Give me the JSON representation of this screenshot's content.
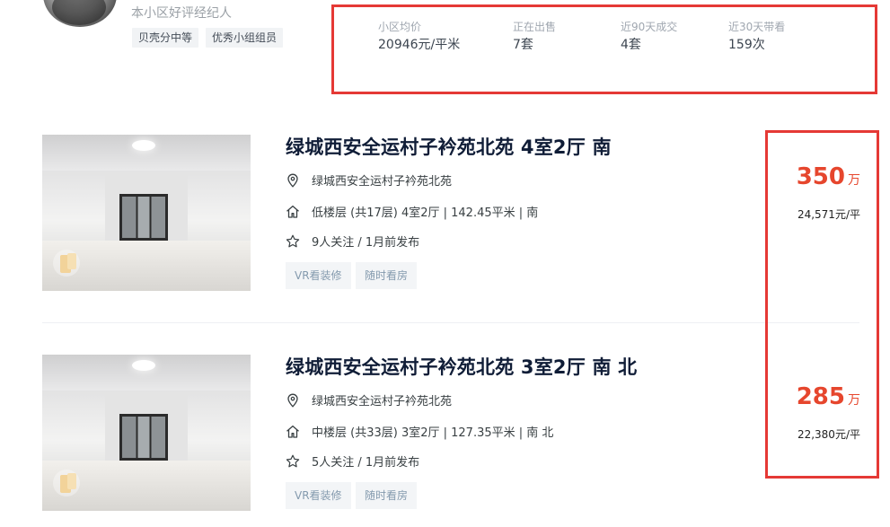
{
  "agent": {
    "description": "本小区好评经纪人",
    "tags": [
      "贝壳分中等",
      "优秀小组组员"
    ]
  },
  "community_stats": [
    {
      "label": "小区均价",
      "value": "20946元/平米"
    },
    {
      "label": "正在出售",
      "value": "7套"
    },
    {
      "label": "近90天成交",
      "value": "4套"
    },
    {
      "label": "近30天带看",
      "value": "159次"
    }
  ],
  "listings": [
    {
      "title": "绿城西安全运村子衿苑北苑 4室2厅 南",
      "community": "绿城西安全运村子衿苑北苑",
      "house_info": "低楼层 (共17层) 4室2厅 | 142.45平米 | 南",
      "follow_info": "9人关注 / 1月前发布",
      "chips": [
        "VR看装修",
        "随时看房"
      ],
      "total_price": "350",
      "total_unit": "万",
      "unit_price": "24,571元/平"
    },
    {
      "title": "绿城西安全运村子衿苑北苑 3室2厅 南 北",
      "community": "绿城西安全运村子衿苑北苑",
      "house_info": "中楼层 (共33层) 3室2厅 | 127.35平米 | 南 北",
      "follow_info": "5人关注 / 1月前发布",
      "chips": [
        "VR看装修",
        "随时看房"
      ],
      "total_price": "285",
      "total_unit": "万",
      "unit_price": "22,380元/平"
    }
  ],
  "colors": {
    "highlight_border": "#e53935",
    "price": "#e6462d",
    "title": "#101d37"
  }
}
